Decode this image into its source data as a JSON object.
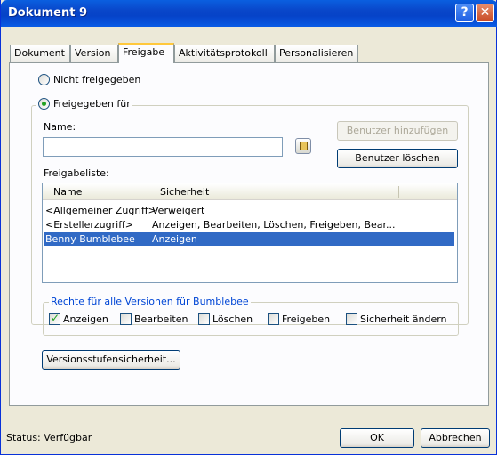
{
  "window": {
    "title": "Dokument 9",
    "help": "?",
    "close": "✕"
  },
  "tabs": [
    {
      "label": "Dokument"
    },
    {
      "label": "Version"
    },
    {
      "label": "Freigabe"
    },
    {
      "label": "Aktivitätsprotokoll"
    },
    {
      "label": "Personalisieren"
    }
  ],
  "sharing": {
    "not_shared": "Nicht freigegeben",
    "shared_for": "Freigegeben für",
    "name_label": "Name:",
    "name_value": "",
    "add_user": "Benutzer hinzufügen",
    "remove_user": "Benutzer löschen",
    "list_label": "Freigabeliste:",
    "columns": [
      "Name",
      "Sicherheit"
    ],
    "rows": [
      {
        "name": "<Allgemeiner Zugriff>",
        "security": "Verweigert"
      },
      {
        "name": "<Erstellerzugriff>",
        "security": "Anzeigen, Bearbeiten, Löschen, Freigeben, Bear..."
      },
      {
        "name": "Benny Bumblebee",
        "security": "Anzeigen"
      }
    ]
  },
  "rights": {
    "legend": "Rechte für alle Versionen für Bumblebee",
    "view": "Anzeigen",
    "edit": "Bearbeiten",
    "delete": "Löschen",
    "share": "Freigeben",
    "change_security": "Sicherheit ändern"
  },
  "version_level_button": "Versionsstufensicherheit...",
  "footer": {
    "status": "Status: Verfügbar",
    "ok": "OK",
    "cancel": "Abbrechen"
  },
  "colors": {
    "titlebar": "#0a5fe0",
    "selection": "#316ac5",
    "active_tab": "#ffc83c"
  }
}
